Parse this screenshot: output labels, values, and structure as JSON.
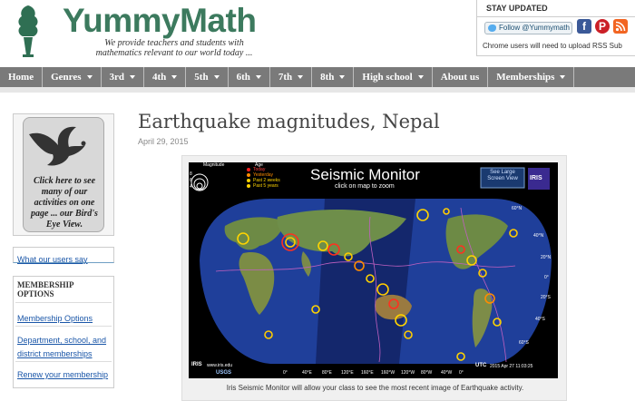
{
  "site": {
    "brand": "YummyMath",
    "tagline": "We provide teachers and students with mathematics relevant to our world today ..."
  },
  "stay_updated": {
    "title": "STAY UPDATED",
    "follow_label": "Follow @Yummymath",
    "note": "Chrome users will need to upload RSS Sub"
  },
  "nav": {
    "items": [
      {
        "label": "Home",
        "dropdown": false
      },
      {
        "label": "Genres",
        "dropdown": true
      },
      {
        "label": "3rd",
        "dropdown": true
      },
      {
        "label": "4th",
        "dropdown": true
      },
      {
        "label": "5th",
        "dropdown": true
      },
      {
        "label": "6th",
        "dropdown": true
      },
      {
        "label": "7th",
        "dropdown": true
      },
      {
        "label": "8th",
        "dropdown": true
      },
      {
        "label": "High school",
        "dropdown": true
      },
      {
        "label": "About us",
        "dropdown": false
      },
      {
        "label": "Memberships",
        "dropdown": true
      }
    ]
  },
  "sidebar": {
    "promo_text": "Click here to see many of our activities on one page ... our Bird's Eye View.",
    "users_link": "What our users say",
    "membership_title": "MEMBERSHIP OPTIONS",
    "membership_links": [
      "Membership Options",
      "Department, school, and district memberships",
      "Renew your membership"
    ]
  },
  "post": {
    "title": "Earthquake magnitudes, Nepal",
    "date": "April 29, 2015",
    "caption": "Iris Seismic Monitor will allow your class to see the most recent image of Earthquake activity."
  },
  "seismic": {
    "title": "Seismic Monitor",
    "subtitle": "click on map to zoom",
    "magnitude_label": "Magnitude",
    "age_label": "Age",
    "age_items": [
      "Today",
      "Yesterday",
      "Past 2 weeks",
      "Past 5 years"
    ],
    "mag_numbers": [
      "8",
      "6",
      "4"
    ],
    "large_view": "See Large Screen View",
    "iris_logo": "IRIS",
    "bottom_left": "IRIS",
    "bottom_url": "www.iris.edu",
    "usgs": "USGS",
    "utc_label": "UTC",
    "timestamp": "2015 Apr 27 11:03:25",
    "lat_labels": [
      "60°N",
      "40°N",
      "20°N",
      "0°",
      "20°S",
      "40°S",
      "60°S"
    ],
    "lon_labels": [
      "0°",
      "40°E",
      "80°E",
      "120°E",
      "160°E",
      "160°W",
      "120°W",
      "80°W",
      "40°W",
      "0°"
    ]
  },
  "colors": {
    "brand_green": "#3c7a5e",
    "nav_bg": "#7a7a7a",
    "link_blue": "#1a56a8"
  }
}
